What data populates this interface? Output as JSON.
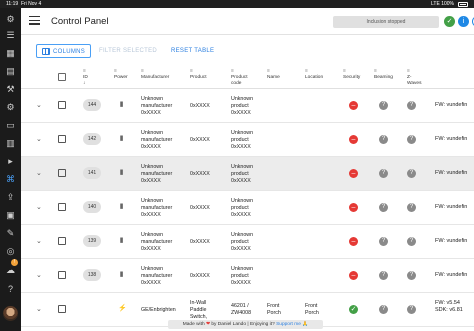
{
  "statusbar": {
    "time": "11:19",
    "date": "Fri Nov 4",
    "signal": "LTE 100%"
  },
  "header": {
    "title": "Control Panel",
    "inclusion_status": "Inclusion stopped",
    "info_icon": "i",
    "refresh_icon": "↻"
  },
  "toolbar": {
    "columns": "COLUMNS",
    "filter": "FILTER SELECTED",
    "reset": "RESET TABLE"
  },
  "columns": {
    "id": "ID",
    "power": "Power",
    "manufacturer": "Manufacturer",
    "product": "Product",
    "product_code": "Product\ncode",
    "name": "Name",
    "location": "Location",
    "security": "Security",
    "beaming": "Beaming",
    "zwave": "Z-\nWaves"
  },
  "rows": [
    {
      "id": "144",
      "manufacturer": "Unknown\nmanufacturer\n0xXXXX",
      "product": "0xXXXX",
      "product_code": "Unknown\nproduct\n0xXXXX",
      "name": "",
      "location": "",
      "fw": "FW: vundefin",
      "security": "no"
    },
    {
      "id": "142",
      "manufacturer": "Unknown\nmanufacturer\n0xXXXX",
      "product": "0xXXXX",
      "product_code": "Unknown\nproduct\n0xXXXX",
      "name": "",
      "location": "",
      "fw": "FW: vundefin",
      "security": "no"
    },
    {
      "id": "141",
      "manufacturer": "Unknown\nmanufacturer\n0xXXXX",
      "product": "0xXXXX",
      "product_code": "Unknown\nproduct\n0xXXXX",
      "name": "",
      "location": "",
      "fw": "FW: vundefin",
      "security": "no"
    },
    {
      "id": "140",
      "manufacturer": "Unknown\nmanufacturer\n0xXXXX",
      "product": "0xXXXX",
      "product_code": "Unknown\nproduct\n0xXXXX",
      "name": "",
      "location": "",
      "fw": "FW: vundefin",
      "security": "no"
    },
    {
      "id": "139",
      "manufacturer": "Unknown\nmanufacturer\n0xXXXX",
      "product": "0xXXXX",
      "product_code": "Unknown\nproduct\n0xXXXX",
      "name": "",
      "location": "",
      "fw": "FW: vundefin",
      "security": "no"
    },
    {
      "id": "138",
      "manufacturer": "Unknown\nmanufacturer\n0xXXXX",
      "product": "0xXXXX",
      "product_code": "Unknown\nproduct\n0xXXXX",
      "name": "",
      "location": "",
      "fw": "FW: vundefin",
      "security": "no"
    },
    {
      "id": "",
      "manufacturer": "GE/Enbrighten",
      "product": "In-Wall\nPaddle\nSwitch,",
      "product_code": "46201 /\nZW4008",
      "name": "Front\nPorch",
      "location": "Front\nPorch",
      "fw": "FW: v5.54\nSDK: v6.81",
      "security": "yes"
    }
  ],
  "footer": {
    "prefix": "Made with",
    "heart": "❤",
    "by": "by Daniel Lando",
    "enjoy": "Enjoying it?",
    "support": "Support me",
    "emoji": "🙏"
  },
  "colors": {
    "accent": "#2b7fe0",
    "security_no": "#e53935",
    "security_yes": "#43a047",
    "status_green": "#43a047",
    "status_blue": "#1e88e5"
  }
}
